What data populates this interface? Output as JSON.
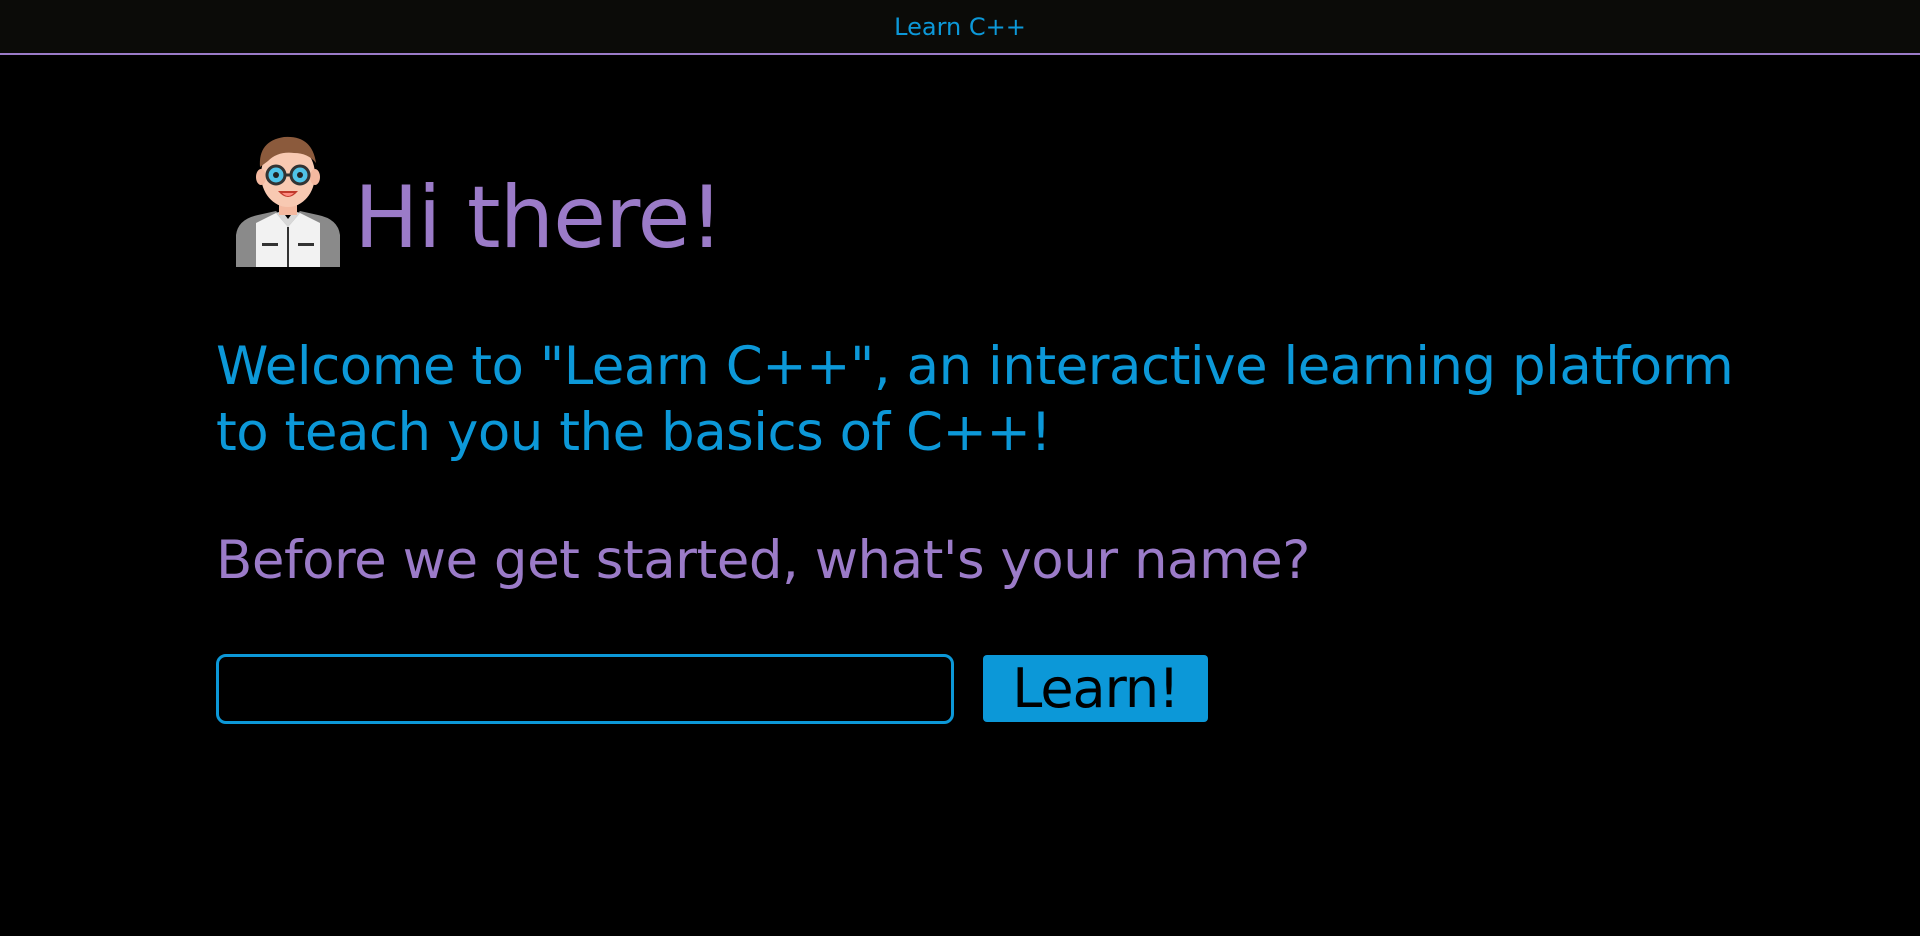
{
  "header": {
    "title": "Learn C++"
  },
  "greeting": {
    "avatar_icon": "programmer-avatar-icon",
    "heading": "Hi there!"
  },
  "intro": {
    "welcome_text": "Welcome to \"Learn C++\", an interactive learning platform to teach you the basics of C++!",
    "name_question": "Before we get started, what's your name?"
  },
  "form": {
    "name_value": "",
    "name_placeholder": "",
    "submit_label": "Learn!"
  },
  "colors": {
    "background": "#000000",
    "header_bg": "#0b0b08",
    "accent_blue": "#0c98d8",
    "accent_purple": "#9b7bc8"
  }
}
